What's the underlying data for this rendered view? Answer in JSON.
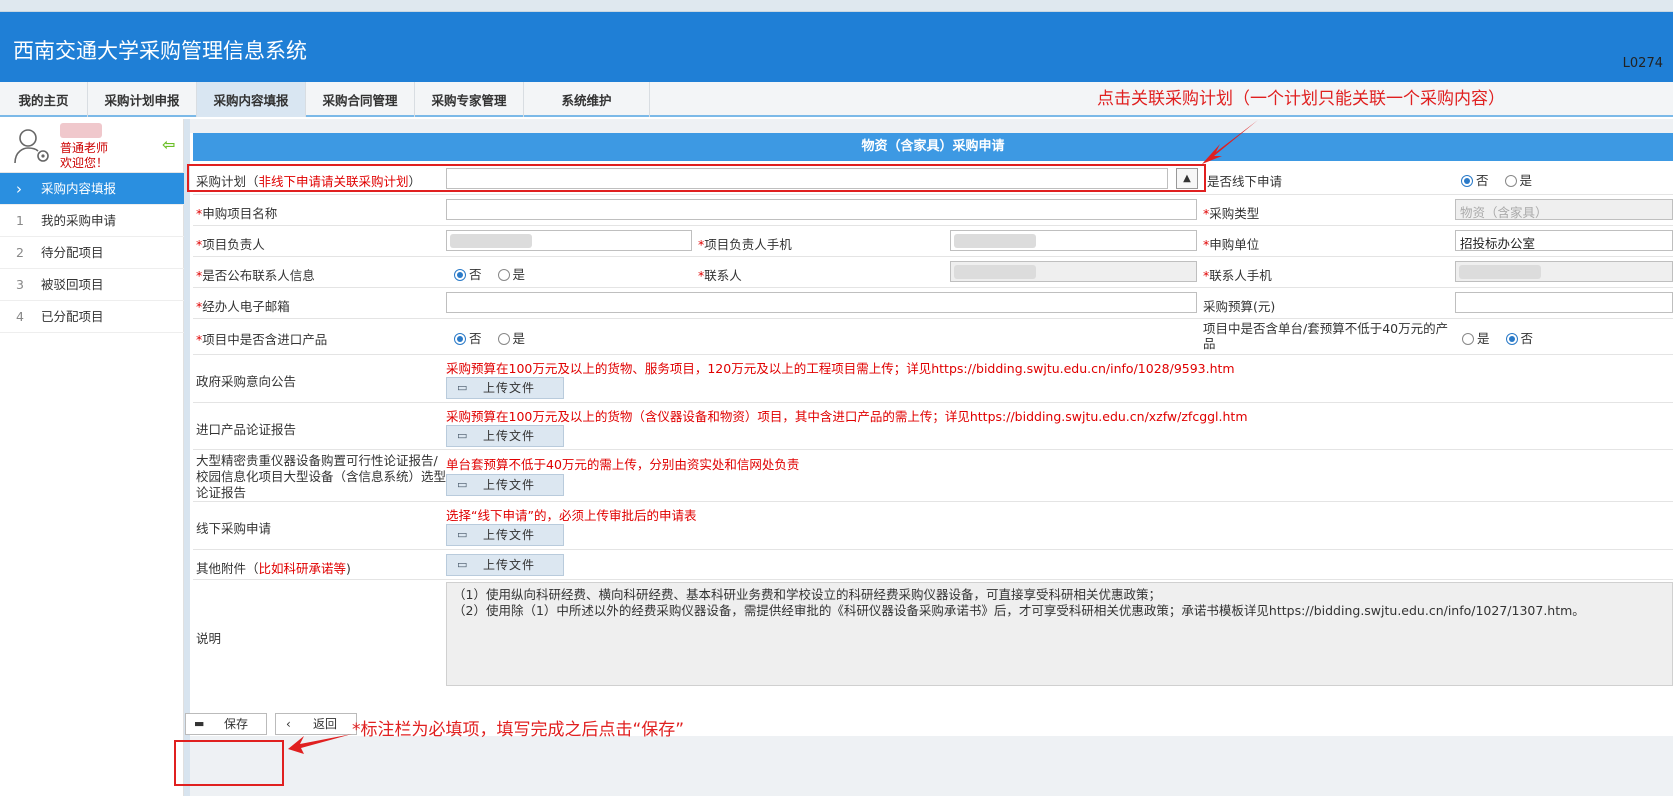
{
  "header": {
    "title": "西南交通大学采购管理信息系统",
    "user_code": "L0274"
  },
  "nav": {
    "tabs": [
      {
        "label": "我的主页"
      },
      {
        "label": "采购计划申报"
      },
      {
        "label": "采购内容填报"
      },
      {
        "label": "采购合同管理"
      },
      {
        "label": "采购专家管理"
      },
      {
        "label": "系统维护"
      }
    ]
  },
  "sidebar": {
    "role": "普通老师",
    "welcome": "欢迎您！",
    "items": [
      {
        "num": "",
        "label": "采购内容填报"
      },
      {
        "num": "1",
        "label": "我的采购申请"
      },
      {
        "num": "2",
        "label": "待分配项目"
      },
      {
        "num": "3",
        "label": "被驳回项目"
      },
      {
        "num": "4",
        "label": "已分配项目"
      }
    ]
  },
  "form": {
    "title": "物资（含家具）采购申请",
    "plan": {
      "label_pre": "采购计划（",
      "label_red": "非线下申请请关联采购计划",
      "label_post": "）"
    },
    "offline": {
      "label": "是否线下申请",
      "options": [
        "否",
        "是"
      ],
      "selected": "否"
    },
    "project_name": {
      "label": "申购项目名称"
    },
    "purchase_type": {
      "label": "采购类型",
      "placeholder": "物资（含家具）"
    },
    "leader": {
      "label": "项目负责人"
    },
    "leader_phone": {
      "label": "项目负责人手机"
    },
    "unit": {
      "label": "申购单位",
      "value": "招投标办公室"
    },
    "publish_contact": {
      "label": "是否公布联系人信息",
      "options": [
        "否",
        "是"
      ],
      "selected": "否"
    },
    "contact": {
      "label": "联系人"
    },
    "contact_phone": {
      "label": "联系人手机"
    },
    "email": {
      "label": "经办人电子邮箱"
    },
    "budget": {
      "label": "采购预算(元)"
    },
    "import": {
      "label": "项目中是否含进口产品",
      "options": [
        "否",
        "是"
      ],
      "selected": "否"
    },
    "single_unit": {
      "label_line1": "项目中是否含单台/套预算不低于40万元的产",
      "label_line2": "品",
      "options": [
        "是",
        "否"
      ],
      "selected": "否"
    },
    "uploads": [
      {
        "label": "政府采购意向公告",
        "note": "采购预算在100万元及以上的货物、服务项目，120万元及以上的工程项目需上传；详见https://bidding.swjtu.edu.cn/info/1028/9593.htm",
        "button": "上传文件"
      },
      {
        "label": "进口产品论证报告",
        "note": "采购预算在100万元及以上的货物（含仪器设备和物资）项目，其中含进口产品的需上传；详见https://bidding.swjtu.edu.cn/xzfw/zfcggl.htm",
        "button": "上传文件"
      },
      {
        "label_lines": [
          "大型精密贵重仪器设备购置可行性论证报告/",
          "校园信息化项目大型设备（含信息系统）选型",
          "论证报告"
        ],
        "note": "单台套预算不低于40万元的需上传，分别由资实处和信网处负责",
        "button": "上传文件"
      },
      {
        "label": "线下采购申请",
        "note": "选择“线下申请”的，必须上传审批后的申请表",
        "button": "上传文件"
      },
      {
        "label_pre": "其他附件（",
        "label_red": "比如科研承诺等",
        "label_post": ")",
        "button": "上传文件"
      }
    ],
    "description": {
      "label": "说明",
      "line1": "（1）使用纵向科研经费、横向科研经费、基本科研业务费和学校设立的科研经费采购仪器设备，可直接享受科研相关优惠政策；",
      "line2": "（2）使用除（1）中所述以外的经费采购仪器设备，需提供经审批的《科研仪器设备采购承诺书》后，才可享受科研相关优惠政策；承诺书模板详见https://bidding.swjtu.edu.cn/info/1027/1307.htm。"
    }
  },
  "actions": {
    "save": "保存",
    "back": "返回"
  },
  "annotations": {
    "top": "点击关联采购计划（一个计划只能关联一个采购内容）",
    "bottom": "*标注栏为必填项，填写完成之后点击“保存”"
  },
  "colors": {
    "header": "#1f7fd6",
    "accent": "#3d99e3",
    "required": "#e00000",
    "annotation": "#e02020"
  }
}
